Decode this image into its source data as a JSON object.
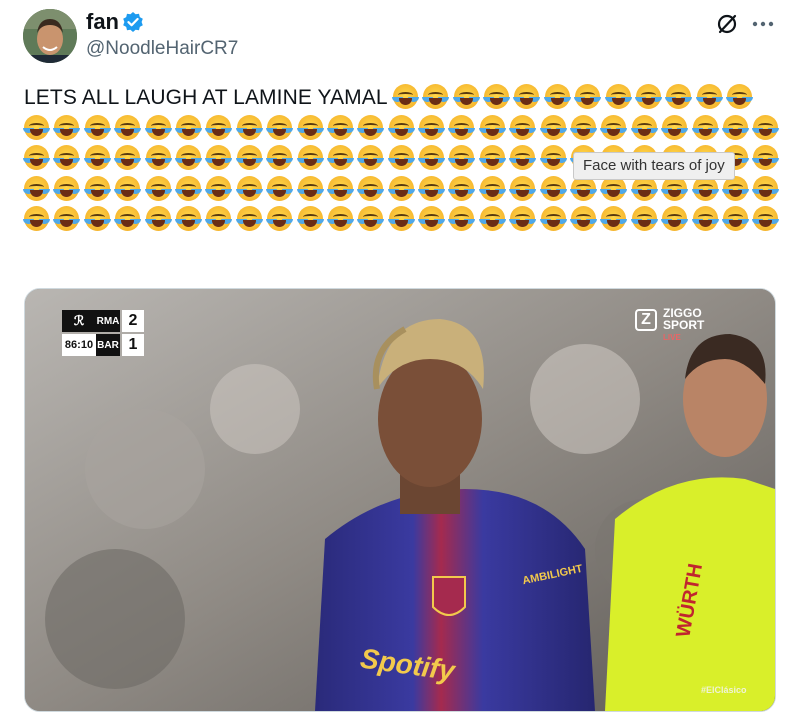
{
  "author": {
    "display_name": "fan",
    "handle": "@NoodleHairCR7",
    "verified_icon": "verified-badge-icon",
    "accent_color": "#1d9bf0"
  },
  "header_actions": {
    "grok_icon": "grok-icon",
    "more_icon": "more-dots-icon"
  },
  "tweet": {
    "text": "LETS ALL LAUGH AT LAMINE YAMAL",
    "emoji_name": "face-with-tears-of-joy",
    "emoji_count": 112,
    "tooltip": "Face with tears of joy"
  },
  "media": {
    "scoreboard": {
      "league_logo": "ℛ",
      "clock": "86:10",
      "home_team": "RMA",
      "home_score": "2",
      "away_team": "BAR",
      "away_score": "1"
    },
    "broadcaster": {
      "logo_letter": "Z",
      "name": "ZIGGO SPORT",
      "status": "LIVE"
    },
    "watermark": "#ElClásico",
    "jersey": {
      "sponsor": "Spotify",
      "sleeve": "AMBILIGHT",
      "referee_sponsor": "WÜRTH"
    }
  }
}
